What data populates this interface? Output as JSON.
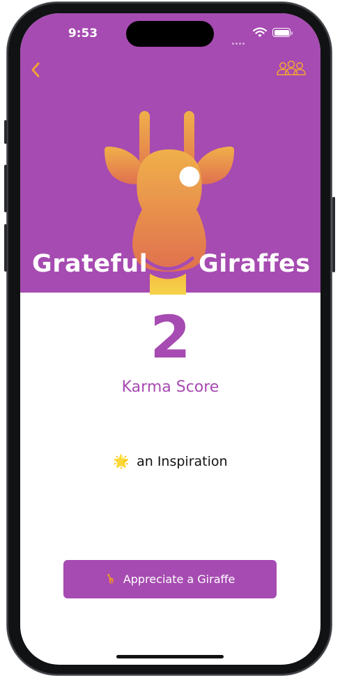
{
  "status_bar": {
    "time": "9:53"
  },
  "nav": {
    "back_icon": "chevron-left-icon",
    "group_icon": "people-group-icon"
  },
  "hero": {
    "title_left": "Grateful",
    "title_right": "Giraffes"
  },
  "karma": {
    "score": "2",
    "label": "Karma Score"
  },
  "rank": {
    "emoji": "🌟",
    "text": "an Inspiration"
  },
  "action": {
    "emoji": "🦒",
    "label": "Appreciate a Giraffe"
  },
  "colors": {
    "brand": "#a64bb1",
    "accent": "#f0a336",
    "background": "#ffffff"
  }
}
